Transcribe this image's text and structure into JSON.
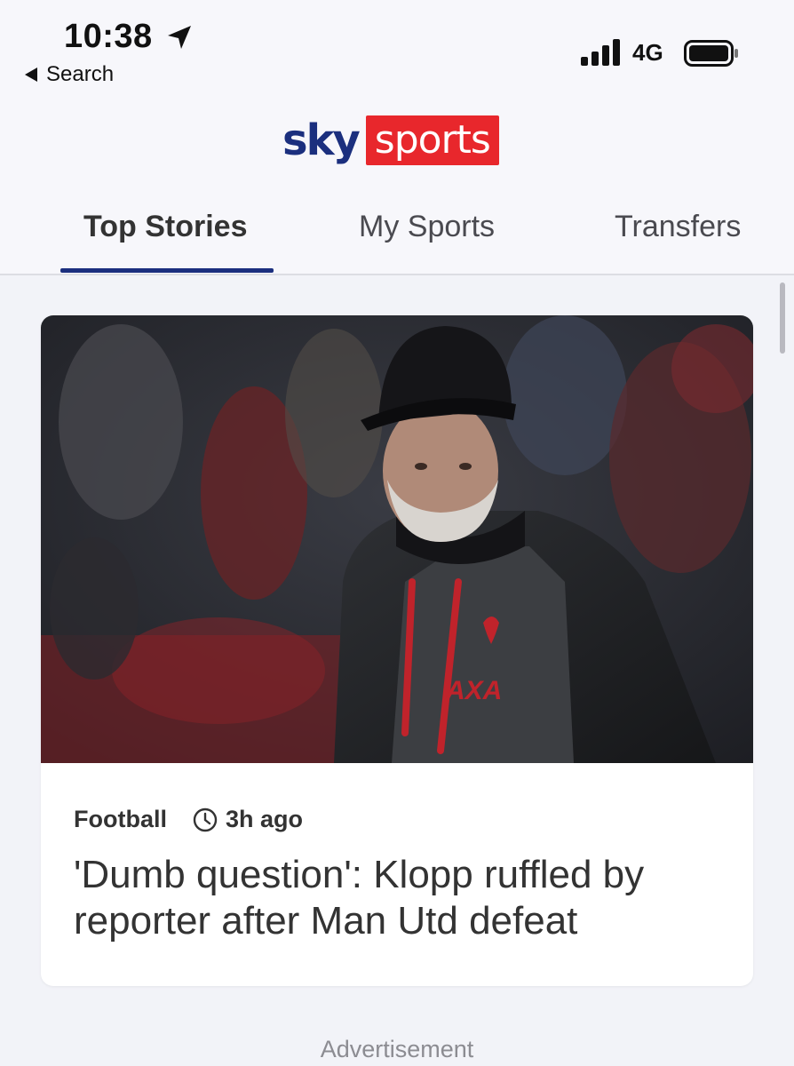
{
  "status_bar": {
    "time": "10:38",
    "back_label": "Search",
    "network": "4G"
  },
  "logo": {
    "sky": "sky",
    "sports": "sports"
  },
  "tabs": [
    {
      "label": "Top Stories",
      "active": true
    },
    {
      "label": "My Sports",
      "active": false
    },
    {
      "label": "Transfers",
      "active": false
    }
  ],
  "article": {
    "category": "Football",
    "time_ago": "3h ago",
    "headline": "'Dumb question': Klopp ruffled by reporter after Man Utd defeat",
    "image_icon": "photo-manager-in-black-cap",
    "crest_text": "AXA"
  },
  "advertisement_label": "Advertisement",
  "colors": {
    "brand_blue": "#1b2f7e",
    "brand_red": "#e8272c",
    "background": "#f2f3f8"
  }
}
